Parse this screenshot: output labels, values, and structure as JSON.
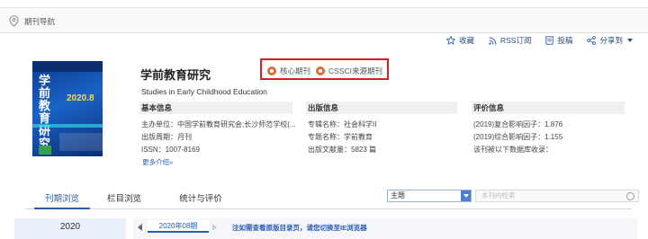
{
  "nav": {
    "label": "期刊导航"
  },
  "toolbar": {
    "favorite": "收藏",
    "rss": "RSS订阅",
    "submit": "投稿",
    "share": "分享到"
  },
  "journal": {
    "title": "学前教育研究",
    "english_title": "Studies in Early Childhood Education",
    "cover_title": "学前教育研究",
    "cover_issue": "2020.8",
    "badges": [
      "核心期刊",
      "CSSCI来源期刊"
    ]
  },
  "basic_info": {
    "header": "基本信息",
    "rows": [
      "主办单位：中国学前教育研究会;长沙师范学校(...",
      "出版周期：月刊",
      "ISSN：1007-8169"
    ],
    "more": "更多介绍»"
  },
  "publish_info": {
    "header": "出版信息",
    "rows": [
      "专辑名称：社会科学II",
      "专题名称：学前教育",
      "出版文献量：5823 篇"
    ]
  },
  "eval_info": {
    "header": "评价信息",
    "rows": [
      "(2019)复合影响因子：1.876",
      "(2019)综合影响因子：1.155",
      "该刊被以下数据库收录："
    ]
  },
  "tabs": [
    "刊期浏览",
    "栏目浏览",
    "统计与评价"
  ],
  "filter": {
    "select_value": "主题",
    "search_placeholder": "本刊内检索"
  },
  "browse": {
    "year": "2020",
    "issue": "2020年08期",
    "notice": "注如需查看原版目录页，请您切换至IE浏览器"
  },
  "colors": {
    "badge_border": "#d42020",
    "link": "#2a5db0",
    "cover_blue": "#1a63c7"
  }
}
